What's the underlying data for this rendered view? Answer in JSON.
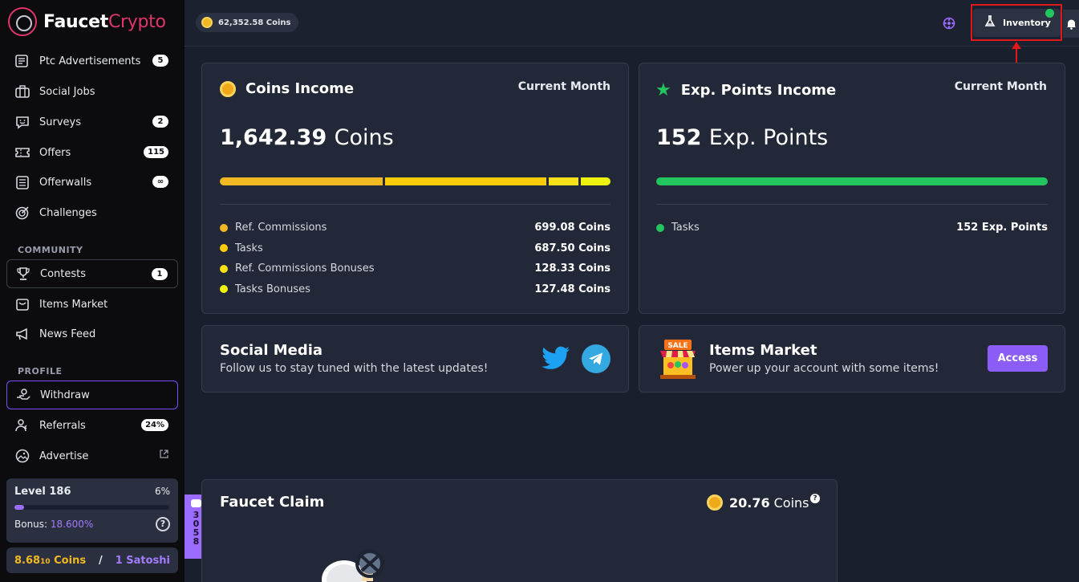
{
  "brand": {
    "name_main": "Faucet",
    "name_accent": "Crypto"
  },
  "sidebar": {
    "items": [
      {
        "label": "Ptc Advertisements",
        "badge": "5",
        "icon": "newspaper-icon"
      },
      {
        "label": "Social Jobs",
        "badge": "",
        "icon": "briefcase-icon"
      },
      {
        "label": "Surveys",
        "badge": "2",
        "icon": "chat-smile-icon"
      },
      {
        "label": "Offers",
        "badge": "115",
        "icon": "ticket-icon"
      },
      {
        "label": "Offerwalls",
        "badge": "∞",
        "icon": "list-icon"
      },
      {
        "label": "Challenges",
        "badge": "",
        "icon": "target-icon"
      }
    ],
    "community_label": "COMMUNITY",
    "community": [
      {
        "label": "Contests",
        "badge": "1",
        "icon": "trophy-icon"
      },
      {
        "label": "Items Market",
        "badge": "",
        "icon": "store-icon"
      },
      {
        "label": "News Feed",
        "badge": "",
        "icon": "megaphone-icon"
      }
    ],
    "profile_label": "PROFILE",
    "profile": [
      {
        "label": "Withdraw",
        "badge": "",
        "icon": "hand-coins-icon"
      },
      {
        "label": "Referrals",
        "badge": "24%",
        "icon": "users-icon"
      },
      {
        "label": "Advertise",
        "badge": "",
        "icon": "image-icon"
      }
    ],
    "level": {
      "label": "Level 186",
      "percent_text": "6%",
      "progress": 0.06,
      "bonus_label": "Bonus:",
      "bonus_value": "18.600%"
    },
    "rate": {
      "coins_main": "8.68",
      "coins_small": "10",
      "coins_unit": " Coins",
      "separator": "/",
      "satoshi": "1 Satoshi"
    },
    "chat": {
      "count_digits": [
        "3",
        "0",
        "5",
        "8"
      ]
    }
  },
  "topbar": {
    "balance": "62,352.58 Coins",
    "inventory_label": "Inventory"
  },
  "coins_income": {
    "title": "Coins Income",
    "period": "Current Month",
    "value": "1,642.39",
    "unit": "Coins",
    "breakdown": [
      {
        "label": "Ref. Commissions",
        "amount": "699.08 Coins",
        "value": 699.08,
        "color": "#f2b823"
      },
      {
        "label": "Tasks",
        "amount": "687.50 Coins",
        "value": 687.5,
        "color": "#fccc0a"
      },
      {
        "label": "Ref. Commissions Bonuses",
        "amount": "128.33 Coins",
        "value": 128.33,
        "color": "#f7e017"
      },
      {
        "label": "Tasks Bonuses",
        "amount": "127.48 Coins",
        "value": 127.48,
        "color": "#eef20f"
      }
    ]
  },
  "exp_income": {
    "title": "Exp. Points Income",
    "period": "Current Month",
    "value": "152",
    "unit": "Exp. Points",
    "breakdown": [
      {
        "label": "Tasks",
        "amount": "152 Exp. Points",
        "value": 152,
        "color": "#22c55e"
      }
    ]
  },
  "social": {
    "title": "Social Media",
    "desc": "Follow us to stay tuned with the latest updates!"
  },
  "market": {
    "title": "Items Market",
    "desc": "Power up your account with some items!",
    "button": "Access",
    "sign": "SALE"
  },
  "faucet": {
    "title": "Faucet Claim",
    "amount": "20.76",
    "unit": "Coins",
    "help": "?"
  }
}
